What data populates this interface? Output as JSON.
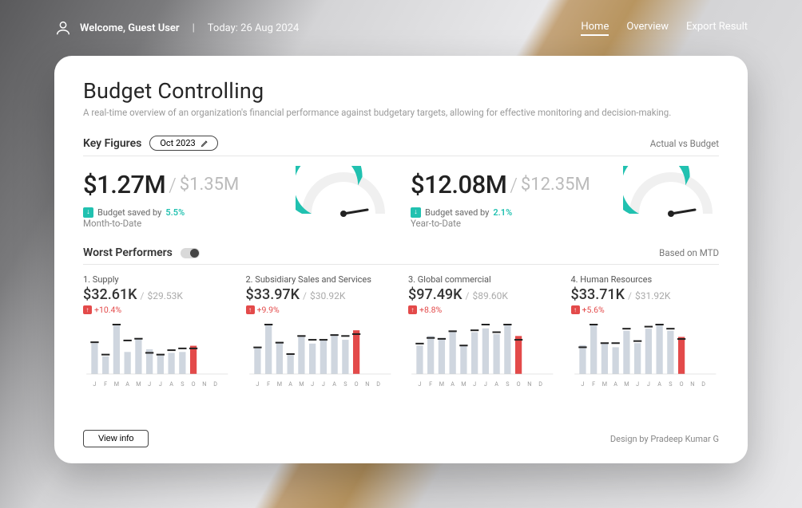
{
  "topbar": {
    "welcome": "Welcome, Guest User",
    "date": "Today: 26 Aug 2024",
    "nav": {
      "home": "Home",
      "overview": "Overview",
      "export": "Export Result"
    }
  },
  "page": {
    "title": "Budget Controlling",
    "subtitle": "A real-time overview of an organization's financial performance against budgetary targets, allowing for effective monitoring and decision-making."
  },
  "key_figures": {
    "label": "Key Figures",
    "period": "Oct 2023",
    "right_note": "Actual vs Budget",
    "mtd": {
      "label": "Month-to-Date",
      "actual": "$1.27M",
      "budget": "$1.35M",
      "saved_text": "Budget saved by",
      "saved_pct": "5.5%"
    },
    "ytd": {
      "label": "Year-to-Date",
      "actual": "$12.08M",
      "budget": "$12.35M",
      "saved_text": "Budget saved by",
      "saved_pct": "2.1%"
    }
  },
  "worst": {
    "label": "Worst Performers",
    "right_note": "Based on MTD",
    "items": [
      {
        "name": "1. Supply",
        "actual": "$32.61K",
        "budget": "$29.53K",
        "delta": "+10.4%"
      },
      {
        "name": "2. Subsidiary Sales and Services",
        "actual": "$33.97K",
        "budget": "$30.92K",
        "delta": "+9.9%"
      },
      {
        "name": "3. Global commercial",
        "actual": "$97.49K",
        "budget": "$89.60K",
        "delta": "+8.8%"
      },
      {
        "name": "4. Human Resources",
        "actual": "$33.71K",
        "budget": "$31.92K",
        "delta": "+5.6%"
      }
    ]
  },
  "footer": {
    "view_info": "View info",
    "design_by": "Design by Pradeep Kumar G"
  },
  "chart_data": {
    "months": [
      "J",
      "F",
      "M",
      "A",
      "M",
      "J",
      "J",
      "A",
      "S",
      "O",
      "N",
      "D"
    ],
    "gauges": [
      {
        "label": "MTD",
        "fill_fraction": 0.65
      },
      {
        "label": "YTD",
        "fill_fraction": 0.65
      }
    ],
    "mini": [
      {
        "name": "Supply",
        "actual": [
          35,
          20,
          55,
          25,
          40,
          28,
          22,
          24,
          25,
          32,
          null,
          null
        ],
        "budget": [
          36,
          22,
          56,
          38,
          40,
          24,
          22,
          27,
          29,
          29,
          null,
          null
        ],
        "highlight_index": 9
      },
      {
        "name": "Subsidiary Sales and Services",
        "actual": [
          28,
          52,
          34,
          20,
          40,
          32,
          36,
          42,
          36,
          46,
          null,
          null
        ],
        "budget": [
          28,
          52,
          33,
          21,
          40,
          36,
          36,
          41,
          40,
          42,
          null,
          null
        ],
        "highlight_index": 9
      },
      {
        "name": "Global commercial",
        "actual": [
          30,
          40,
          38,
          45,
          30,
          44,
          48,
          42,
          52,
          40,
          null,
          null
        ],
        "budget": [
          32,
          38,
          37,
          45,
          30,
          46,
          52,
          44,
          52,
          36,
          null,
          null
        ],
        "highlight_index": 9
      },
      {
        "name": "Human Resources",
        "actual": [
          28,
          48,
          30,
          26,
          42,
          30,
          44,
          48,
          42,
          36,
          null,
          null
        ],
        "budget": [
          26,
          48,
          30,
          30,
          44,
          32,
          46,
          48,
          44,
          34,
          null,
          null
        ],
        "highlight_index": 9
      }
    ]
  }
}
